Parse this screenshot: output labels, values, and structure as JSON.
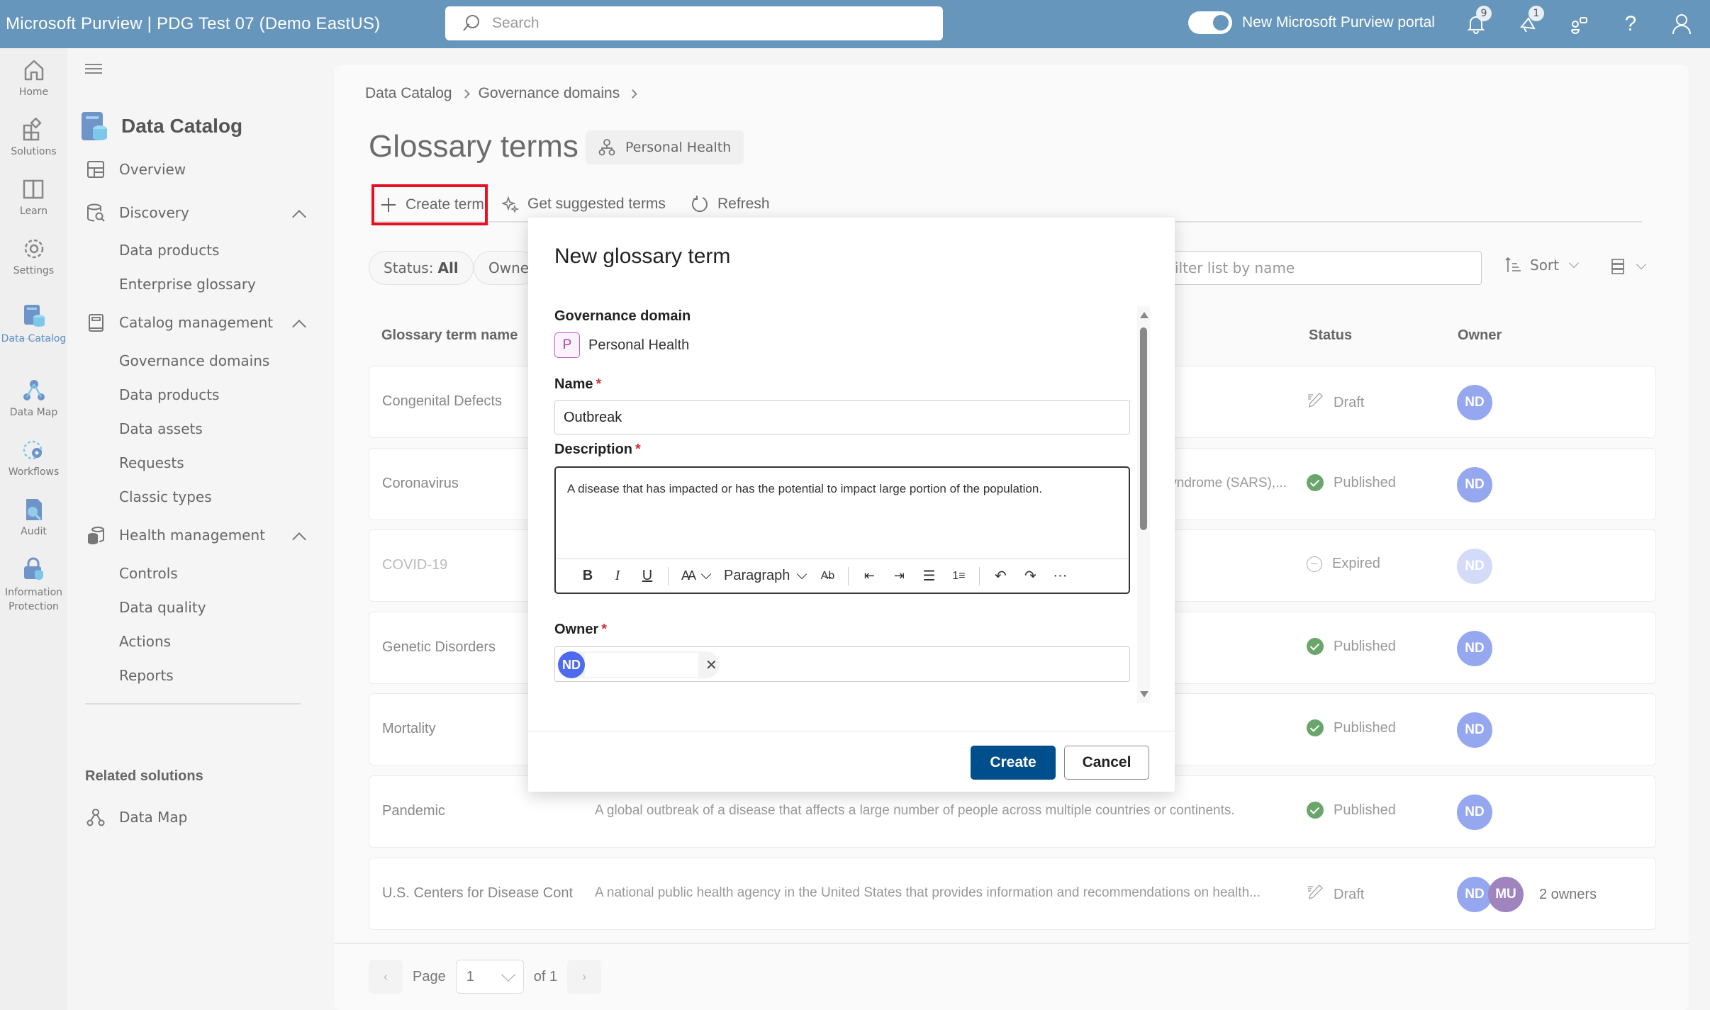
{
  "topbar": {
    "app_title": "Microsoft Purview | PDG Test 07 (Demo EastUS)",
    "search_placeholder": "Search",
    "toggle_label": "New Microsoft Purview portal",
    "toggle_on": true,
    "notifications_count": "9",
    "announcements_count": "1",
    "icons": [
      "bell-icon",
      "megaphone-icon",
      "feedback-icon",
      "help-icon",
      "account-icon"
    ]
  },
  "rail": {
    "items": [
      {
        "label": "Home",
        "icon": "home-icon"
      },
      {
        "label": "Solutions",
        "icon": "solutions-icon"
      },
      {
        "label": "Learn",
        "icon": "book-icon"
      },
      {
        "label": "Settings",
        "icon": "gear-icon"
      },
      {
        "label": "Data Catalog",
        "icon": "data-catalog-icon",
        "active": true
      },
      {
        "label": "Data Map",
        "icon": "data-map-icon"
      },
      {
        "label": "Workflows",
        "icon": "workflows-icon"
      },
      {
        "label": "Audit",
        "icon": "audit-icon"
      },
      {
        "label": "Information Protection",
        "icon": "information-protection-icon"
      }
    ]
  },
  "nav": {
    "title": "Data Catalog",
    "items": [
      {
        "label": "Overview",
        "icon": "overview-icon",
        "level": 1
      },
      {
        "label": "Discovery",
        "icon": "discovery-icon",
        "level": 1,
        "expanded": true
      },
      {
        "label": "Data products",
        "level": 2
      },
      {
        "label": "Enterprise glossary",
        "level": 2
      },
      {
        "label": "Catalog management",
        "icon": "catalog-management-icon",
        "level": 1,
        "expanded": true
      },
      {
        "label": "Governance domains",
        "level": 2
      },
      {
        "label": "Data products",
        "level": 2
      },
      {
        "label": "Data assets",
        "level": 2
      },
      {
        "label": "Requests",
        "level": 2
      },
      {
        "label": "Classic types",
        "level": 2
      },
      {
        "label": "Health management",
        "icon": "health-management-icon",
        "level": 1,
        "expanded": true
      },
      {
        "label": "Controls",
        "level": 2
      },
      {
        "label": "Data quality",
        "level": 2
      },
      {
        "label": "Actions",
        "level": 2
      },
      {
        "label": "Reports",
        "level": 2
      }
    ],
    "related_title": "Related solutions",
    "related_items": [
      {
        "label": "Data Map",
        "icon": "data-map-icon"
      }
    ]
  },
  "main": {
    "breadcrumb": [
      "Data Catalog",
      "Governance domains"
    ],
    "title": "Glossary terms",
    "domain_chip": "Personal Health",
    "commands": {
      "create": "Create term",
      "suggest": "Get suggested terms",
      "refresh": "Refresh"
    },
    "filters": {
      "status_prefix": "Status: ",
      "status_value": "All",
      "owner": "Owner"
    },
    "filter_placeholder": "Filter list by name",
    "sort_label": "Sort",
    "columns": {
      "name": "Glossary term name",
      "name_sort_indicator": "1",
      "status": "Status",
      "owner": "Owner"
    },
    "rows": [
      {
        "name": "Congenital Defects",
        "description": "",
        "status": "Draft",
        "owners": [
          "ND"
        ],
        "owners_label": ""
      },
      {
        "name": "Coronavirus",
        "description": "yndrome (SARS),...",
        "status": "Published",
        "owners": [
          "ND"
        ],
        "owners_label": ""
      },
      {
        "name": "COVID-19",
        "description": "",
        "status": "Expired",
        "owners": [
          "ND"
        ],
        "owners_label": ""
      },
      {
        "name": "Genetic Disorders",
        "description": "",
        "status": "Published",
        "owners": [
          "ND"
        ],
        "owners_label": ""
      },
      {
        "name": "Mortality",
        "description": "",
        "status": "Published",
        "owners": [
          "ND"
        ],
        "owners_label": ""
      },
      {
        "name": "Pandemic",
        "description": "A global outbreak of a disease that affects a large number of people across multiple countries or continents.",
        "status": "Published",
        "owners": [
          "ND"
        ],
        "owners_label": ""
      },
      {
        "name": "U.S. Centers for Disease Cont",
        "description": "A national public health agency in the United States that provides information and recommendations on health...",
        "status": "Draft",
        "owners": [
          "ND",
          "MU"
        ],
        "owners_label": "2 owners"
      }
    ],
    "pager": {
      "page_label": "Page",
      "current": "1",
      "of_label": "of 1"
    }
  },
  "dialog": {
    "title": "New glossary term",
    "domain_label": "Governance domain",
    "domain_initial": "P",
    "domain_value": "Personal Health",
    "name_label": "Name",
    "name_value": "Outbreak",
    "description_label": "Description",
    "description_value": "A disease that has impacted or has the potential to impact large portion of the population.",
    "toolbar": {
      "bold": "B",
      "italic": "I",
      "underline": "U",
      "font_size": "AA",
      "paragraph": "Paragraph",
      "more": "···"
    },
    "owner_label": "Owner",
    "owner_initials": "ND",
    "required_mark": "*",
    "create_label": "Create",
    "cancel_label": "Cancel"
  },
  "colors": {
    "topbar": "#6696bb",
    "primary_button": "#004e8c",
    "highlight_border": "#e81123",
    "published": "#6aa66c",
    "avatar_nd": "#95a7ef",
    "avatar_mu": "#a084bd",
    "domain_badge": "#b044b0"
  }
}
